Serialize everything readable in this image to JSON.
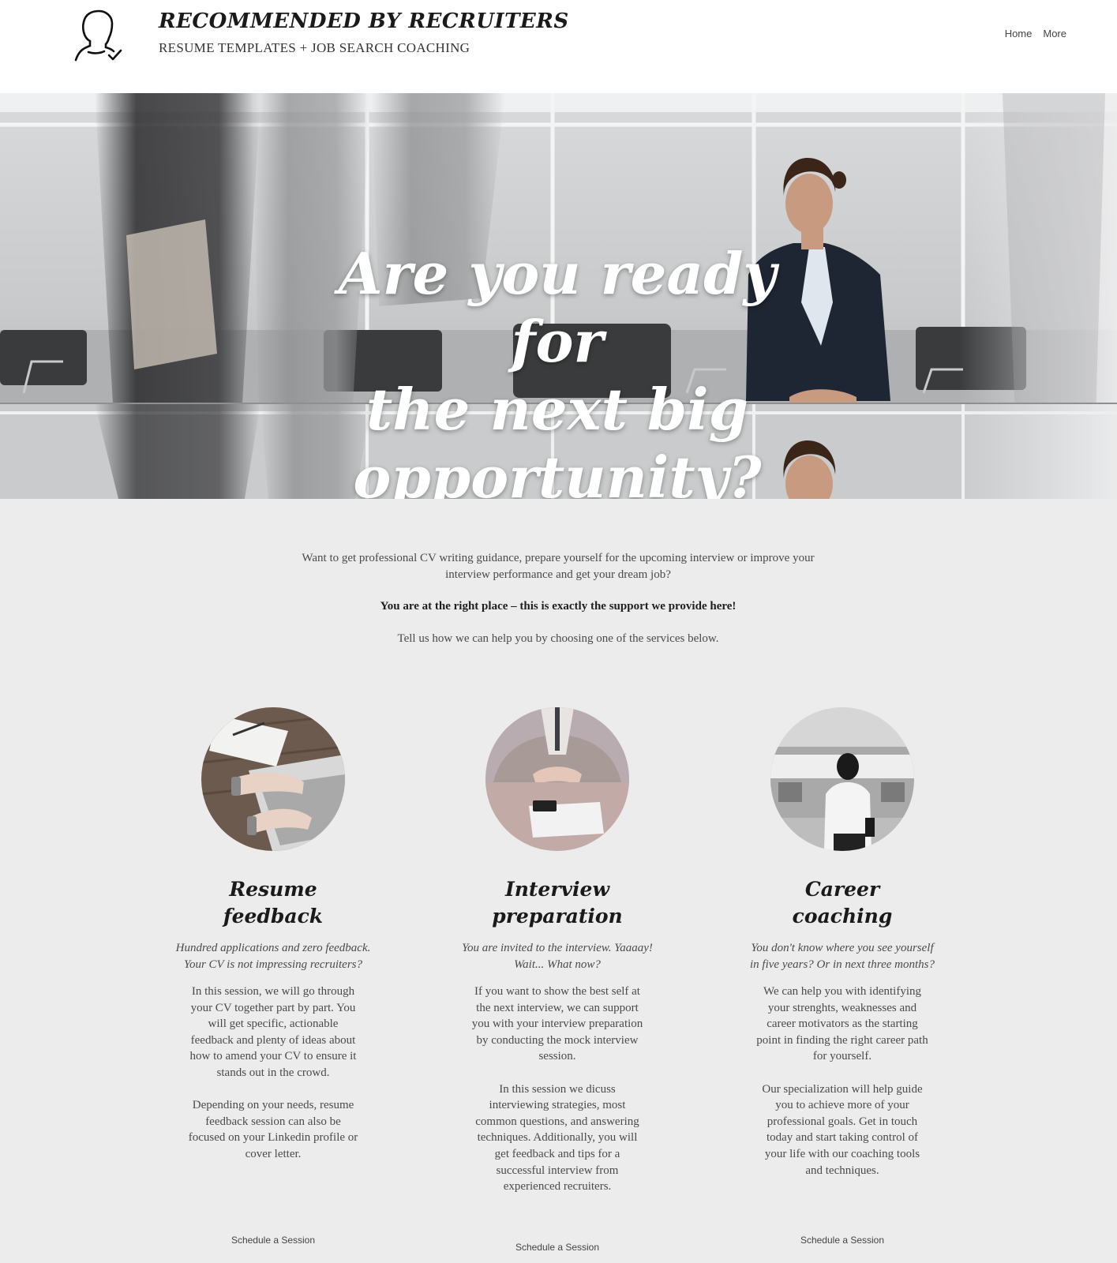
{
  "header": {
    "brand_title": "RECOMMENDED BY RECRUITERS",
    "brand_subtitle": "RESUME TEMPLATES + JOB SEARCH COACHING",
    "logo_icon": "person-check-icon",
    "nav": [
      {
        "label": "Home"
      },
      {
        "label": "More"
      }
    ]
  },
  "hero": {
    "heading_lines": [
      "Are you ready for",
      "the next big",
      "opportunity?"
    ]
  },
  "intro": {
    "line1": "Want to get professional CV writing guidance, prepare yourself for the upcoming interview or improve your interview performance and get your dream job?",
    "bold": "You are at the right place – this is exactly the support we provide here!",
    "tell": "Tell us how we can help you by choosing one of the services below."
  },
  "services": [
    {
      "title_lines": [
        "Resume",
        "feedback"
      ],
      "tagline_lines": [
        "Hundred applications and zero feedback.",
        "Your CV is not impressing recruiters?"
      ],
      "paragraphs": [
        "In this session, we will go through your CV together part by part. You will get specific, actionable feedback and plenty of ideas about how to amend your CV to ensure it stands out in the crowd.",
        "Depending on your needs, resume feedback session can also be focused on your Linkedin profile or cover letter."
      ],
      "button": "Schedule a Session"
    },
    {
      "title_lines": [
        "Interview",
        "preparation"
      ],
      "tagline_lines": [
        "You are invited to the interview. Yaaaay!",
        "Wait... What now?"
      ],
      "paragraphs": [
        "If you want to show the best self at the next interview, we can support you with your interview preparation by conducting the mock interview session.",
        "In this session we dicuss interviewing strategies, most common questions, and answering techniques. Additionally, you will get feedback and tips for a successful interview from experienced recruiters."
      ],
      "button": "Schedule a Session"
    },
    {
      "title_lines": [
        "Career",
        "coaching"
      ],
      "tagline_lines": [
        "You don't know where you see yourself",
        "in five years? Or in next three months?"
      ],
      "paragraphs": [
        "We can help you with identifying your strenghts, weaknesses and career motivators as the starting point in finding the right career path for yourself.",
        "Our specialization will help guide you to achieve more of your professional goals. Get in touch today and start taking control of your life with our coaching tools and techniques."
      ],
      "button": "Schedule a Session"
    }
  ]
}
